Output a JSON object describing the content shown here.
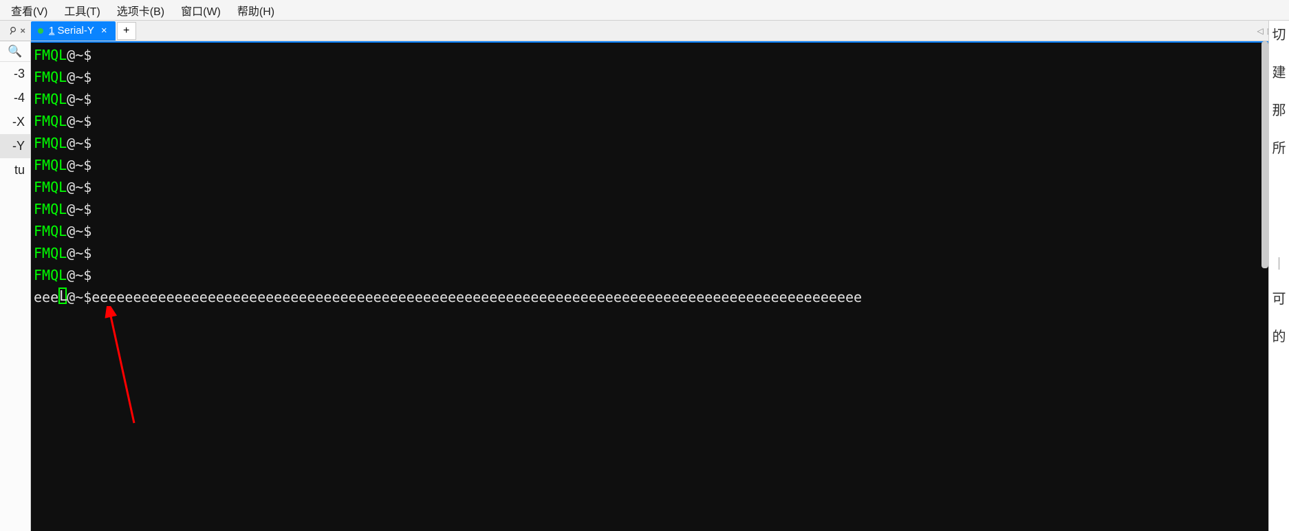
{
  "menu": {
    "view": "查看(V)",
    "tools": "工具(T)",
    "tabs": "选项卡(B)",
    "window": "窗口(W)",
    "help": "帮助(H)"
  },
  "tab": {
    "prefix_number": "1",
    "label": "Serial-Y"
  },
  "sessions": [
    {
      "label": "-3"
    },
    {
      "label": "-4"
    },
    {
      "label": "-X"
    },
    {
      "label": "-Y"
    },
    {
      "label": "tu"
    }
  ],
  "terminal": {
    "prompt_user": "FMQL",
    "prompt_suffix": "@~$",
    "prompt_lines_count": 11,
    "last_line_prefix": "eee",
    "last_line_cursor_char": "L",
    "last_line_middle": "@~$",
    "last_line_tail": "eeeeeeeeeeeeeeeeeeeeeeeeeeeeeeeeeeeeeeeeeeeeeeeeeeeeeeeeeeeeeeeeeeeeeeeeeeeeeeeeeeeeeeeeeeeee"
  },
  "right_edge": {
    "t1": "切",
    "t2": "建",
    "t3": "那",
    "t4": "所",
    "t5": "可",
    "t6": "的"
  }
}
